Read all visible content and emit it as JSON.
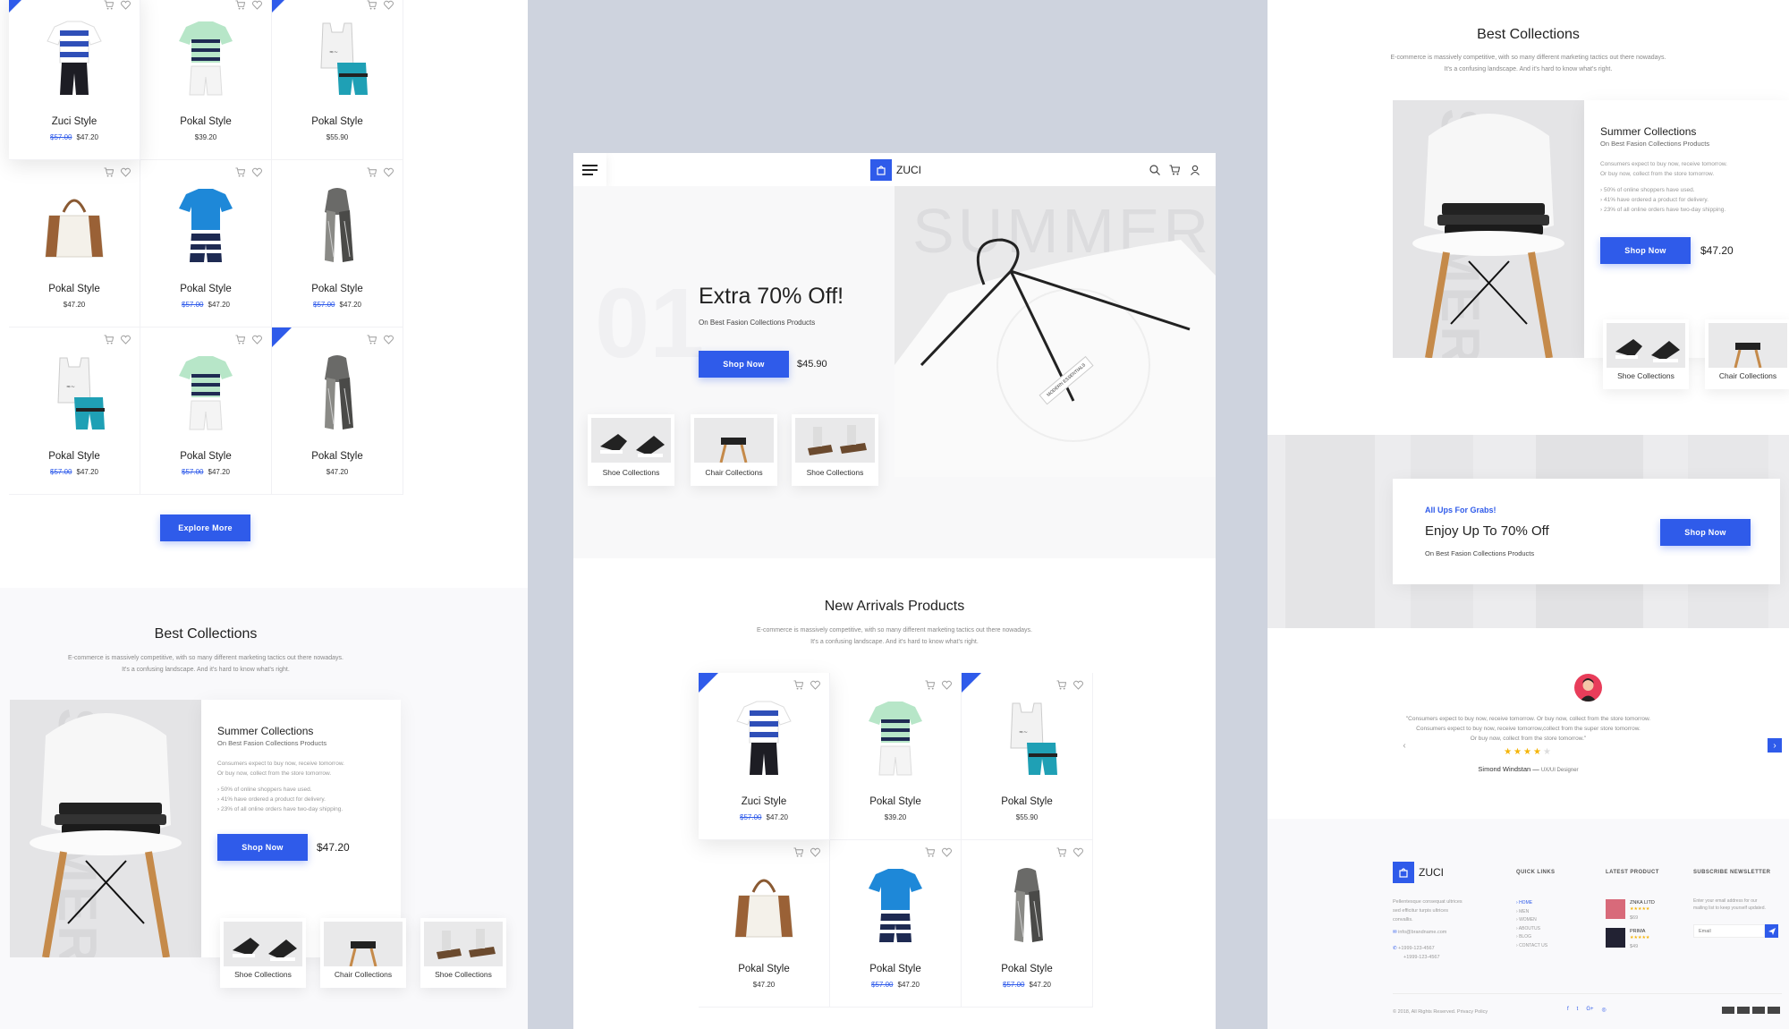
{
  "colors": {
    "accent": "#2f5bea",
    "middle_background": "#ced3de",
    "panel_background": "#ffffff",
    "muted_text": "#999999"
  },
  "brand": {
    "name": "ZUCI",
    "logo_icon": "shopping-bag-icon"
  },
  "grid_left": [
    {
      "name": "Zuci Style",
      "old": "$57.00",
      "price": "$47.20",
      "badge": true,
      "img": "tshirt-shorts"
    },
    {
      "name": "Pokal Style",
      "old": "",
      "price": "$39.20",
      "badge": false,
      "img": "striped-tshirt-shorts"
    },
    {
      "name": "Pokal Style",
      "old": "",
      "price": "$55.90",
      "badge": true,
      "img": "tank-shorts"
    },
    {
      "name": "Pokal Style",
      "old": "",
      "price": "$47.20",
      "badge": false,
      "img": "bag"
    },
    {
      "name": "Pokal Style",
      "old": "$57.00",
      "price": "$47.20",
      "badge": false,
      "img": "blue-tshirt-shorts"
    },
    {
      "name": "Pokal Style",
      "old": "$57.00",
      "price": "$47.20",
      "badge": false,
      "img": "scarf"
    },
    {
      "name": "Pokal Style",
      "old": "$57.00",
      "price": "$47.20",
      "badge": false,
      "img": "tank-shorts"
    },
    {
      "name": "Pokal Style",
      "old": "$57.00",
      "price": "$47.20",
      "badge": false,
      "img": "striped-tshirt-shorts"
    },
    {
      "name": "Pokal Style",
      "old": "",
      "price": "$47.20",
      "badge": true,
      "img": "scarf"
    }
  ],
  "explore_label": "Explore More",
  "best_collections": {
    "title": "Best Collections",
    "desc_line1": "E-commerce is massively competitive, with so many different marketing tactics out there nowadays.",
    "desc_line2": "It's a confusing landscape. And it's hard to know what's right.",
    "watermark": "SUMMER",
    "card_title": "Summer Collections",
    "card_sub": "On Best Fasion Collections Products",
    "card_text1": "Consumers expect to buy now, receive tomorrow.",
    "card_text2": "Or buy now, collect from the store tomorrow.",
    "bullets": [
      "50% of online shoppers have used.",
      "41% have ordered a product for delivery.",
      "23% of all online orders have two-day shipping."
    ],
    "shop_label": "Shop Now",
    "price": "$47.20",
    "minis": [
      "Shoe Collections",
      "Chair Collections",
      "Shoe Collections"
    ]
  },
  "phone": {
    "hero_number": "01",
    "hero_bg_word": "SUMMER",
    "hero_title": "Extra 70% Off!",
    "hero_sub": "On Best Fasion Collections Products",
    "hero_shop": "Shop Now",
    "hero_price": "$45.90",
    "tag_text": "MODERN ESSENTIALS",
    "minis": [
      "Shoe Collections",
      "Chair Collections",
      "Shoe Collections"
    ],
    "arrivals_title": "New Arrivals Products",
    "arrivals_desc1": "E-commerce is massively competitive, with so many different marketing tactics out there nowadays.",
    "arrivals_desc2": "It's a confusing landscape. And it's hard to know what's right.",
    "grid": [
      {
        "name": "Zuci Style",
        "old": "$57.00",
        "price": "$47.20",
        "badge": true,
        "img": "tshirt-shorts"
      },
      {
        "name": "Pokal Style",
        "old": "",
        "price": "$39.20",
        "badge": false,
        "img": "striped-tshirt-shorts"
      },
      {
        "name": "Pokal Style",
        "old": "",
        "price": "$55.90",
        "badge": true,
        "img": "tank-shorts"
      },
      {
        "name": "Pokal Style",
        "old": "",
        "price": "$47.20",
        "badge": false,
        "img": "bag"
      },
      {
        "name": "Pokal Style",
        "old": "$57.00",
        "price": "$47.20",
        "badge": false,
        "img": "blue-tshirt-shorts"
      },
      {
        "name": "Pokal Style",
        "old": "$57.00",
        "price": "$47.20",
        "badge": false,
        "img": "scarf"
      }
    ]
  },
  "right": {
    "title": "Best Collections",
    "desc_line1": "E-commerce is massively competitive, with so many different marketing tactics out there nowadays.",
    "desc_line2": "It's a confusing landscape. And it's hard to know what's right.",
    "watermark": "SUMMER",
    "card_title": "Summer Collections",
    "card_sub": "On Best Fasion Collections Products",
    "card_text1": "Consumers expect to buy now, receive tomorrow.",
    "card_text2": "Or buy now, collect from the store tomorrow.",
    "bullets": [
      "50% of online shoppers have used.",
      "41% have ordered a product for delivery.",
      "23% of all online orders have two-day shipping."
    ],
    "shop_label": "Shop Now",
    "price": "$47.20",
    "minis": [
      "Shoe Collections",
      "Chair Collections"
    ],
    "promo_kicker": "All Ups For Grabs!",
    "promo_title": "Enjoy Up To 70% Off",
    "promo_sub": "On Best Fasion Collections Products",
    "promo_shop": "Shop Now",
    "testimonial_l1": "\"Consumers expect to buy now, receive tomorrow. Or buy now, collect from the store tomorrow.",
    "testimonial_l2": "Consumers expect to buy now, receive tomorrow,collect from the super store tomorrow.",
    "testimonial_l3": "Or buy now, collect from the store tomorrow.\"",
    "rating": 4,
    "rating_max": 5,
    "author": "Simond Windstan",
    "author_role": "UX/UI Designer",
    "footer": {
      "about1": "Pellentesque consequat ultrices",
      "about2": "sed efficitur turpis ultrices",
      "about3": "convallis.",
      "email": "info@brandname.com",
      "phone1": "+1999-123-4567",
      "phone2": "+1999-123-4567",
      "quick_title": "QUICK LINKS",
      "quick_links": [
        "HOME",
        "MEN",
        "WOMEN",
        "ABOUTUS",
        "BLOG",
        "CONTACT US"
      ],
      "latest_title": "LATEST PRODUCT",
      "latest": [
        {
          "name": "ZNKA LITD",
          "price": "$69"
        },
        {
          "name": "PRIMA",
          "price": "$49"
        }
      ],
      "newsletter_title": "SUBSCRIBE NEWSLETTER",
      "newsletter_text1": "Enter your email address for our",
      "newsletter_text2": "mailing list to keep yourself updated.",
      "email_placeholder": "Email",
      "copyright": "© 2018, All Rights Reserved. Privacy Policy",
      "social_icons": [
        "facebook-icon",
        "twitter-icon",
        "google-plus-icon",
        "instagram-icon"
      ],
      "payment_icons": [
        "card-icon-1",
        "card-icon-2",
        "card-icon-3",
        "card-icon-4"
      ]
    }
  }
}
